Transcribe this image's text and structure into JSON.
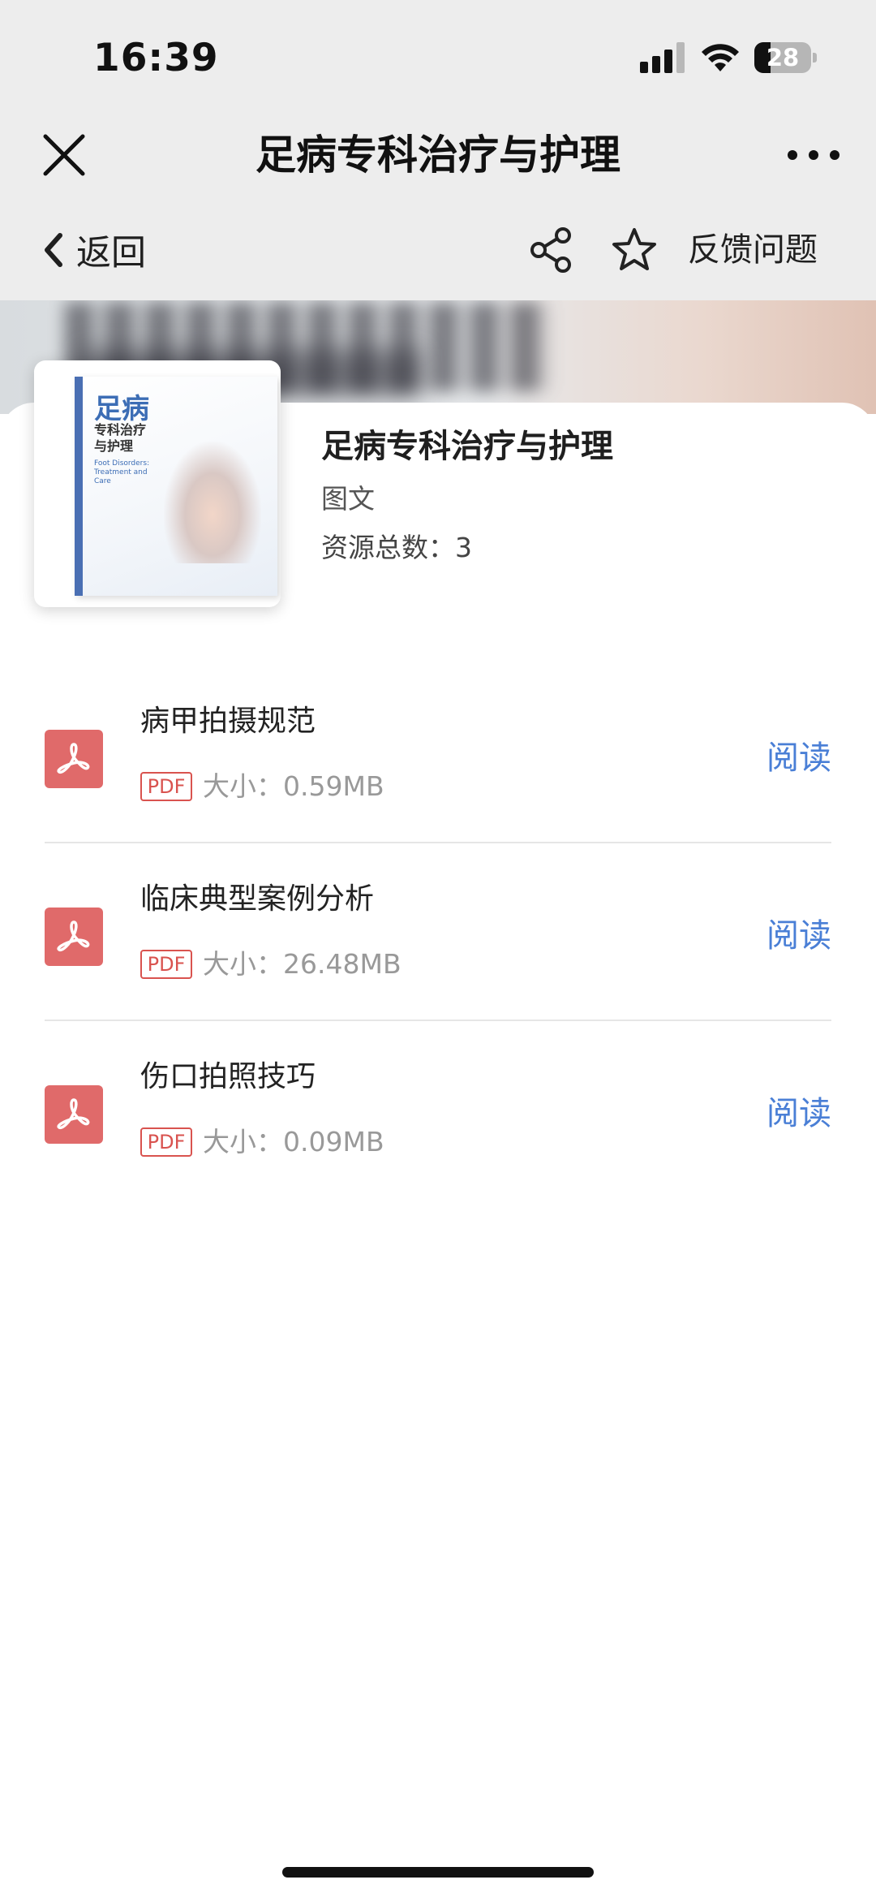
{
  "status_bar": {
    "time": "16:39",
    "battery": "28",
    "battery_level_pct": 28
  },
  "title_bar": {
    "title": "足病专科治疗与护理"
  },
  "action_bar": {
    "back_label": "返回",
    "feedback_label": "反馈问题"
  },
  "cover": {
    "title_line1": "足病",
    "title_line2": "专科治疗\n与护理",
    "subtitle": "Foot Disorders: Treatment and Care"
  },
  "book": {
    "title": "足病专科治疗与护理",
    "type": "图文",
    "count_label": "资源总数：3"
  },
  "resources": [
    {
      "name": "病甲拍摄规范",
      "badge": "PDF",
      "size": "大小：0.59MB",
      "action": "阅读"
    },
    {
      "name": "临床典型案例分析",
      "badge": "PDF",
      "size": "大小：26.48MB",
      "action": "阅读"
    },
    {
      "name": "伤口拍照技巧",
      "badge": "PDF",
      "size": "大小：0.09MB",
      "action": "阅读"
    }
  ],
  "colors": {
    "accent_link": "#4a7fd6",
    "pdf_red": "#e06a6a",
    "header_bg": "#ededed"
  }
}
